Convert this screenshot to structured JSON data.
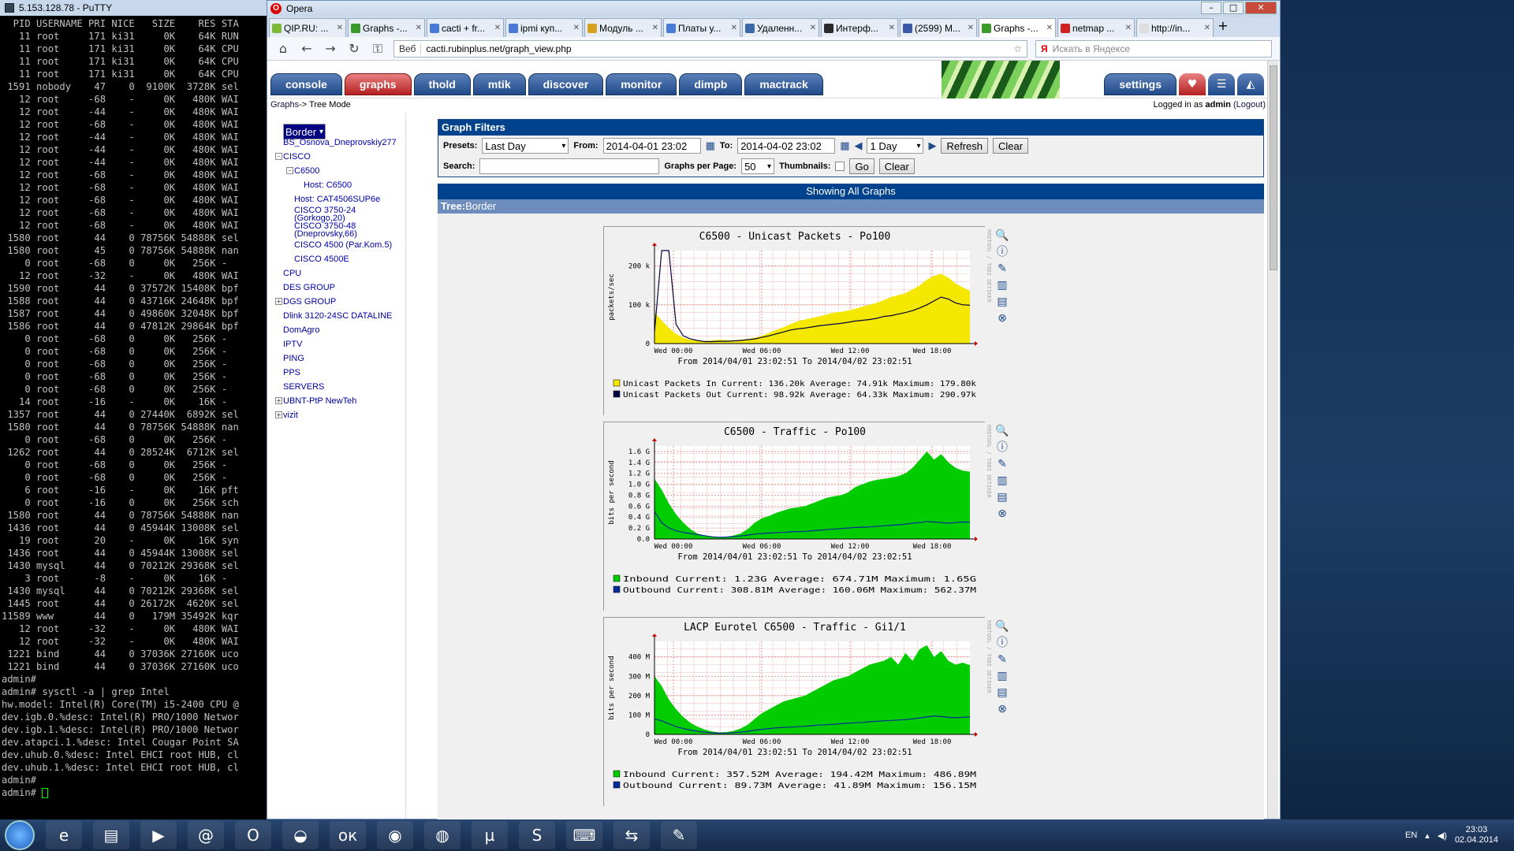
{
  "putty": {
    "title": "5.153.128.78 - PuTTY",
    "header": "  PID USERNAME PRI NICE   SIZE    RES STA",
    "rows": [
      "   11 root     171 ki31     0K    64K RUN",
      "   11 root     171 ki31     0K    64K CPU",
      "   11 root     171 ki31     0K    64K CPU",
      "   11 root     171 ki31     0K    64K CPU",
      " 1591 nobody    47    0  9100K  3728K sel",
      "   12 root     -68    -     0K   480K WAI",
      "   12 root     -44    -     0K   480K WAI",
      "   12 root     -68    -     0K   480K WAI",
      "   12 root     -44    -     0K   480K WAI",
      "   12 root     -44    -     0K   480K WAI",
      "   12 root     -44    -     0K   480K WAI",
      "   12 root     -68    -     0K   480K WAI",
      "   12 root     -68    -     0K   480K WAI",
      "   12 root     -68    -     0K   480K WAI",
      "   12 root     -68    -     0K   480K WAI",
      "   12 root     -68    -     0K   480K WAI",
      " 1580 root      44    0 78756K 54888K sel",
      " 1580 root      45    0 78756K 54888K nan",
      "    0 root     -68    0     0K   256K -",
      "   12 root     -32    -     0K   480K WAI",
      " 1590 root      44    0 37572K 15408K bpf",
      " 1588 root      44    0 43716K 24648K bpf",
      " 1587 root      44    0 49860K 32048K bpf",
      " 1586 root      44    0 47812K 29864K bpf",
      "    0 root     -68    0     0K   256K -",
      "    0 root     -68    0     0K   256K -",
      "    0 root     -68    0     0K   256K -",
      "    0 root     -68    0     0K   256K -",
      "    0 root     -68    0     0K   256K -",
      "   14 root     -16    -     0K    16K -",
      " 1357 root      44    0 27440K  6892K sel",
      " 1580 root      44    0 78756K 54888K nan",
      "    0 root     -68    0     0K   256K -",
      " 1262 root      44    0 28524K  6712K sel",
      "    0 root     -68    0     0K   256K -",
      "    0 root     -68    0     0K   256K -",
      "    6 root     -16    -     0K    16K pft",
      "    0 root     -16    0     0K   256K sch",
      " 1580 root      44    0 78756K 54888K nan",
      " 1436 root      44    0 45944K 13008K sel",
      "   19 root      20    -     0K    16K syn",
      " 1436 root      44    0 45944K 13008K sel",
      " 1430 mysql     44    0 70212K 29368K sel",
      "    3 root      -8    -     0K    16K -",
      " 1430 mysql     44    0 70212K 29368K sel",
      " 1445 root      44    0 26172K  4620K sel",
      "11589 www       44    0   179M 35492K kqr",
      "   12 root     -32    -     0K   480K WAI",
      "   12 root     -32    -     0K   480K WAI",
      " 1221 bind      44    0 37036K 27160K uco",
      " 1221 bind      44    0 37036K 27160K uco"
    ],
    "cmds": [
      "admin#",
      "admin# sysctl -a | grep Intel",
      "hw.model: Intel(R) Core(TM) i5-2400 CPU @",
      "dev.igb.0.%desc: Intel(R) PRO/1000 Networ",
      "dev.igb.1.%desc: Intel(R) PRO/1000 Networ",
      "dev.atapci.1.%desc: Intel Cougar Point SA",
      "dev.uhub.0.%desc: Intel EHCI root HUB, cl",
      "dev.uhub.1.%desc: Intel EHCI root HUB, cl",
      "admin#"
    ],
    "prompt": "admin# "
  },
  "opera": {
    "title": "Opera",
    "tabs": [
      {
        "label": "QIP.RU: ...",
        "color": "#7cba38"
      },
      {
        "label": "Graphs -...",
        "color": "#3a9a2a"
      },
      {
        "label": "cacti + fr...",
        "color": "#4a7ad8"
      },
      {
        "label": "ipmi куп...",
        "color": "#4a7ad8"
      },
      {
        "label": "Модуль ...",
        "color": "#d8a020"
      },
      {
        "label": "Платы у...",
        "color": "#4a7ad8"
      },
      {
        "label": "Удаленн...",
        "color": "#3a6aa8"
      },
      {
        "label": "Интерф...",
        "color": "#2a2a2a"
      },
      {
        "label": "(2599) M...",
        "color": "#3a5aa8"
      },
      {
        "label": "Graphs -...",
        "color": "#3a9a2a",
        "active": true
      },
      {
        "label": "netmap ...",
        "color": "#d02020"
      },
      {
        "label": "http://in...",
        "color": "#dddddd"
      }
    ],
    "url_prefix": "Веб",
    "url": "cacti.rubinplus.net/graph_view.php",
    "search_placeholder": "Искать в Яндексе"
  },
  "cacti": {
    "tabs": [
      "console",
      "graphs",
      "thold",
      "mtik",
      "discover",
      "monitor",
      "dimpb",
      "mactrack"
    ],
    "settings": "settings",
    "crumb_link": "Graphs",
    "crumb_rest": " -> Tree Mode",
    "logged_prefix": "Logged in as ",
    "user": "admin",
    "logout": "(Logout)",
    "tree": [
      {
        "label": "Border",
        "selected": true
      },
      {
        "label": "BS_Osnova_Dneprovskiy277"
      },
      {
        "label": "CISCO"
      },
      {
        "label": "C6500"
      },
      {
        "label": "Host: C6500"
      },
      {
        "label": "Host: CAT4506SUP6e"
      },
      {
        "label": "CISCO 3750-24"
      },
      {
        "label": "(Gorkogo,20)"
      },
      {
        "label": "CISCO 3750-48"
      },
      {
        "label": "(Dneprovsky,66)"
      },
      {
        "label": "CISCO 4500 (Par.Kom.5)"
      },
      {
        "label": "CISCO 4500E"
      },
      {
        "label": "CPU"
      },
      {
        "label": "DES GROUP"
      },
      {
        "label": "DGS GROUP"
      },
      {
        "label": "Dlink 3120-24SC DATALINE"
      },
      {
        "label": "DomAgro"
      },
      {
        "label": "IPTV"
      },
      {
        "label": "PING"
      },
      {
        "label": "PPS"
      },
      {
        "label": "SERVERS"
      },
      {
        "label": "UBNT-PtP NewTeh"
      },
      {
        "label": "vizit"
      }
    ],
    "filters": {
      "title": "Graph Filters",
      "presets_label": "Presets:",
      "presets_value": "Last Day",
      "from_label": "From:",
      "from_value": "2014-04-01 23:02",
      "to_label": "To:",
      "to_value": "2014-04-02 23:02",
      "span_value": "1 Day",
      "refresh": "Refresh",
      "clear": "Clear",
      "search_label": "Search:",
      "search_value": "",
      "gpp_label": "Graphs per Page:",
      "gpp_value": "50",
      "thumbs_label": "Thumbnails:",
      "go": "Go",
      "clear2": "Clear"
    },
    "showing": "Showing All Graphs",
    "tree_label": "Tree:",
    "tree_name": "Border"
  },
  "chart_data": [
    {
      "type": "area",
      "title": "C6500 - Unicast Packets - Po100",
      "ylabel": "packets/sec",
      "ylim": [
        0,
        240000
      ],
      "yticks": [
        {
          "v": 0,
          "l": "0"
        },
        {
          "v": 100000,
          "l": "100 k"
        },
        {
          "v": 200000,
          "l": "200 k"
        }
      ],
      "xticks": [
        {
          "v": 0.06,
          "l": "Wed 00:00"
        },
        {
          "v": 0.34,
          "l": "Wed 06:00"
        },
        {
          "v": 0.62,
          "l": "Wed 12:00"
        },
        {
          "v": 0.88,
          "l": "Wed 18:00"
        }
      ],
      "subtitle": "From 2014/04/01 23:02:51 To 2014/04/02 23:02:51",
      "series": [
        {
          "name": "Unicast Packets In",
          "kind": "area",
          "color": "#f5e800",
          "values": [
            80000,
            60000,
            40000,
            25000,
            15000,
            10000,
            8000,
            7000,
            8000,
            10000,
            9000,
            8000,
            10000,
            12000,
            15000,
            20000,
            28000,
            35000,
            42000,
            50000,
            58000,
            62000,
            66000,
            70000,
            75000,
            80000,
            82000,
            85000,
            90000,
            95000,
            100000,
            105000,
            112000,
            120000,
            125000,
            130000,
            140000,
            150000,
            165000,
            175000,
            180000,
            170000,
            155000,
            145000,
            136000
          ],
          "current": "136.20k",
          "average": "74.91k",
          "maximum": "179.80k"
        },
        {
          "name": "Unicast Packets Out",
          "kind": "line",
          "color": "#000040",
          "values": [
            30000,
            290000,
            280000,
            50000,
            20000,
            12000,
            8000,
            5000,
            5000,
            6000,
            6000,
            7000,
            8000,
            10000,
            12000,
            16000,
            20000,
            25000,
            30000,
            35000,
            38000,
            40000,
            43000,
            46000,
            48000,
            50000,
            52000,
            55000,
            58000,
            60000,
            62000,
            65000,
            70000,
            72000,
            76000,
            80000,
            85000,
            92000,
            100000,
            110000,
            120000,
            115000,
            105000,
            100000,
            98900
          ],
          "current": "98.92k",
          "average": "64.33k",
          "maximum": "290.97k"
        }
      ]
    },
    {
      "type": "area",
      "title": "C6500 - Traffic - Po100",
      "ylabel": "bits per second",
      "ylim": [
        0,
        1700000000
      ],
      "yticks": [
        {
          "v": 0,
          "l": "0.0"
        },
        {
          "v": 200000000,
          "l": "0.2 G"
        },
        {
          "v": 400000000,
          "l": "0.4 G"
        },
        {
          "v": 600000000,
          "l": "0.6 G"
        },
        {
          "v": 800000000,
          "l": "0.8 G"
        },
        {
          "v": 1000000000,
          "l": "1.0 G"
        },
        {
          "v": 1200000000,
          "l": "1.2 G"
        },
        {
          "v": 1400000000,
          "l": "1.4 G"
        },
        {
          "v": 1600000000,
          "l": "1.6 G"
        }
      ],
      "xticks": [
        {
          "v": 0.06,
          "l": "Wed 00:00"
        },
        {
          "v": 0.34,
          "l": "Wed 06:00"
        },
        {
          "v": 0.62,
          "l": "Wed 12:00"
        },
        {
          "v": 0.88,
          "l": "Wed 18:00"
        }
      ],
      "subtitle": "From 2014/04/01 23:02:51 To 2014/04/02 23:02:51",
      "series": [
        {
          "name": "Inbound",
          "kind": "area",
          "color": "#00cc00",
          "values": [
            1100000000,
            900000000,
            650000000,
            450000000,
            300000000,
            180000000,
            100000000,
            60000000,
            40000000,
            30000000,
            40000000,
            60000000,
            100000000,
            180000000,
            300000000,
            380000000,
            420000000,
            480000000,
            520000000,
            560000000,
            580000000,
            600000000,
            650000000,
            700000000,
            750000000,
            780000000,
            800000000,
            850000000,
            950000000,
            1000000000,
            1050000000,
            1080000000,
            1100000000,
            1120000000,
            1150000000,
            1200000000,
            1300000000,
            1450000000,
            1600000000,
            1450000000,
            1550000000,
            1400000000,
            1300000000,
            1250000000,
            1230000000
          ],
          "current": "1.23G",
          "average": "674.71M",
          "maximum": "1.65G"
        },
        {
          "name": "Outbound",
          "kind": "line",
          "color": "#002a97",
          "values": [
            500000000,
            300000000,
            200000000,
            150000000,
            120000000,
            100000000,
            80000000,
            60000000,
            40000000,
            30000000,
            35000000,
            45000000,
            55000000,
            70000000,
            90000000,
            100000000,
            110000000,
            115000000,
            120000000,
            130000000,
            135000000,
            140000000,
            150000000,
            160000000,
            170000000,
            180000000,
            190000000,
            200000000,
            210000000,
            215000000,
            220000000,
            230000000,
            240000000,
            250000000,
            260000000,
            270000000,
            290000000,
            300000000,
            320000000,
            310000000,
            300000000,
            290000000,
            300000000,
            310000000,
            308810000
          ],
          "current": "308.81M",
          "average": "160.06M",
          "maximum": "562.37M"
        }
      ]
    },
    {
      "type": "area",
      "title": "LACP Eurotel C6500 - Traffic - Gi1/1",
      "ylabel": "bits per second",
      "ylim": [
        0,
        480000000
      ],
      "yticks": [
        {
          "v": 0,
          "l": "0"
        },
        {
          "v": 100000000,
          "l": "100 M"
        },
        {
          "v": 200000000,
          "l": "200 M"
        },
        {
          "v": 300000000,
          "l": "300 M"
        },
        {
          "v": 400000000,
          "l": "400 M"
        }
      ],
      "xticks": [
        {
          "v": 0.06,
          "l": "Wed 00:00"
        },
        {
          "v": 0.34,
          "l": "Wed 06:00"
        },
        {
          "v": 0.62,
          "l": "Wed 12:00"
        },
        {
          "v": 0.88,
          "l": "Wed 18:00"
        }
      ],
      "subtitle": "From 2014/04/01 23:02:51 To 2014/04/02 23:02:51",
      "series": [
        {
          "name": "Inbound",
          "kind": "area",
          "color": "#00cc00",
          "values": [
            300000000,
            250000000,
            180000000,
            130000000,
            90000000,
            60000000,
            40000000,
            25000000,
            15000000,
            10000000,
            12000000,
            18000000,
            30000000,
            50000000,
            80000000,
            110000000,
            130000000,
            150000000,
            170000000,
            180000000,
            190000000,
            200000000,
            220000000,
            240000000,
            260000000,
            280000000,
            290000000,
            300000000,
            320000000,
            340000000,
            360000000,
            370000000,
            380000000,
            400000000,
            360000000,
            420000000,
            380000000,
            440000000,
            460000000,
            400000000,
            430000000,
            380000000,
            360000000,
            370000000,
            357520000
          ],
          "current": "357.52M",
          "average": "194.42M",
          "maximum": "486.89M"
        },
        {
          "name": "Outbound",
          "kind": "line",
          "color": "#002a97",
          "values": [
            80000000,
            70000000,
            55000000,
            40000000,
            30000000,
            22000000,
            16000000,
            12000000,
            8000000,
            6000000,
            7000000,
            9000000,
            12000000,
            16000000,
            22000000,
            26000000,
            30000000,
            34000000,
            36000000,
            38000000,
            40000000,
            42000000,
            45000000,
            48000000,
            50000000,
            52000000,
            55000000,
            58000000,
            60000000,
            62000000,
            65000000,
            68000000,
            70000000,
            72000000,
            74000000,
            76000000,
            80000000,
            85000000,
            90000000,
            95000000,
            92000000,
            88000000,
            86000000,
            88000000,
            89730000
          ],
          "current": "89.73M",
          "average": "41.89M",
          "maximum": "156.15M"
        }
      ]
    }
  ],
  "legend_labels": {
    "current": "Current:",
    "average": "Average:",
    "maximum": "Maximum:"
  },
  "rrd_text": "RRDTOOL / TOBI OETIKER",
  "desktop": {
    "lang": "EN",
    "time": "23:03",
    "date": "02.04.2014"
  }
}
